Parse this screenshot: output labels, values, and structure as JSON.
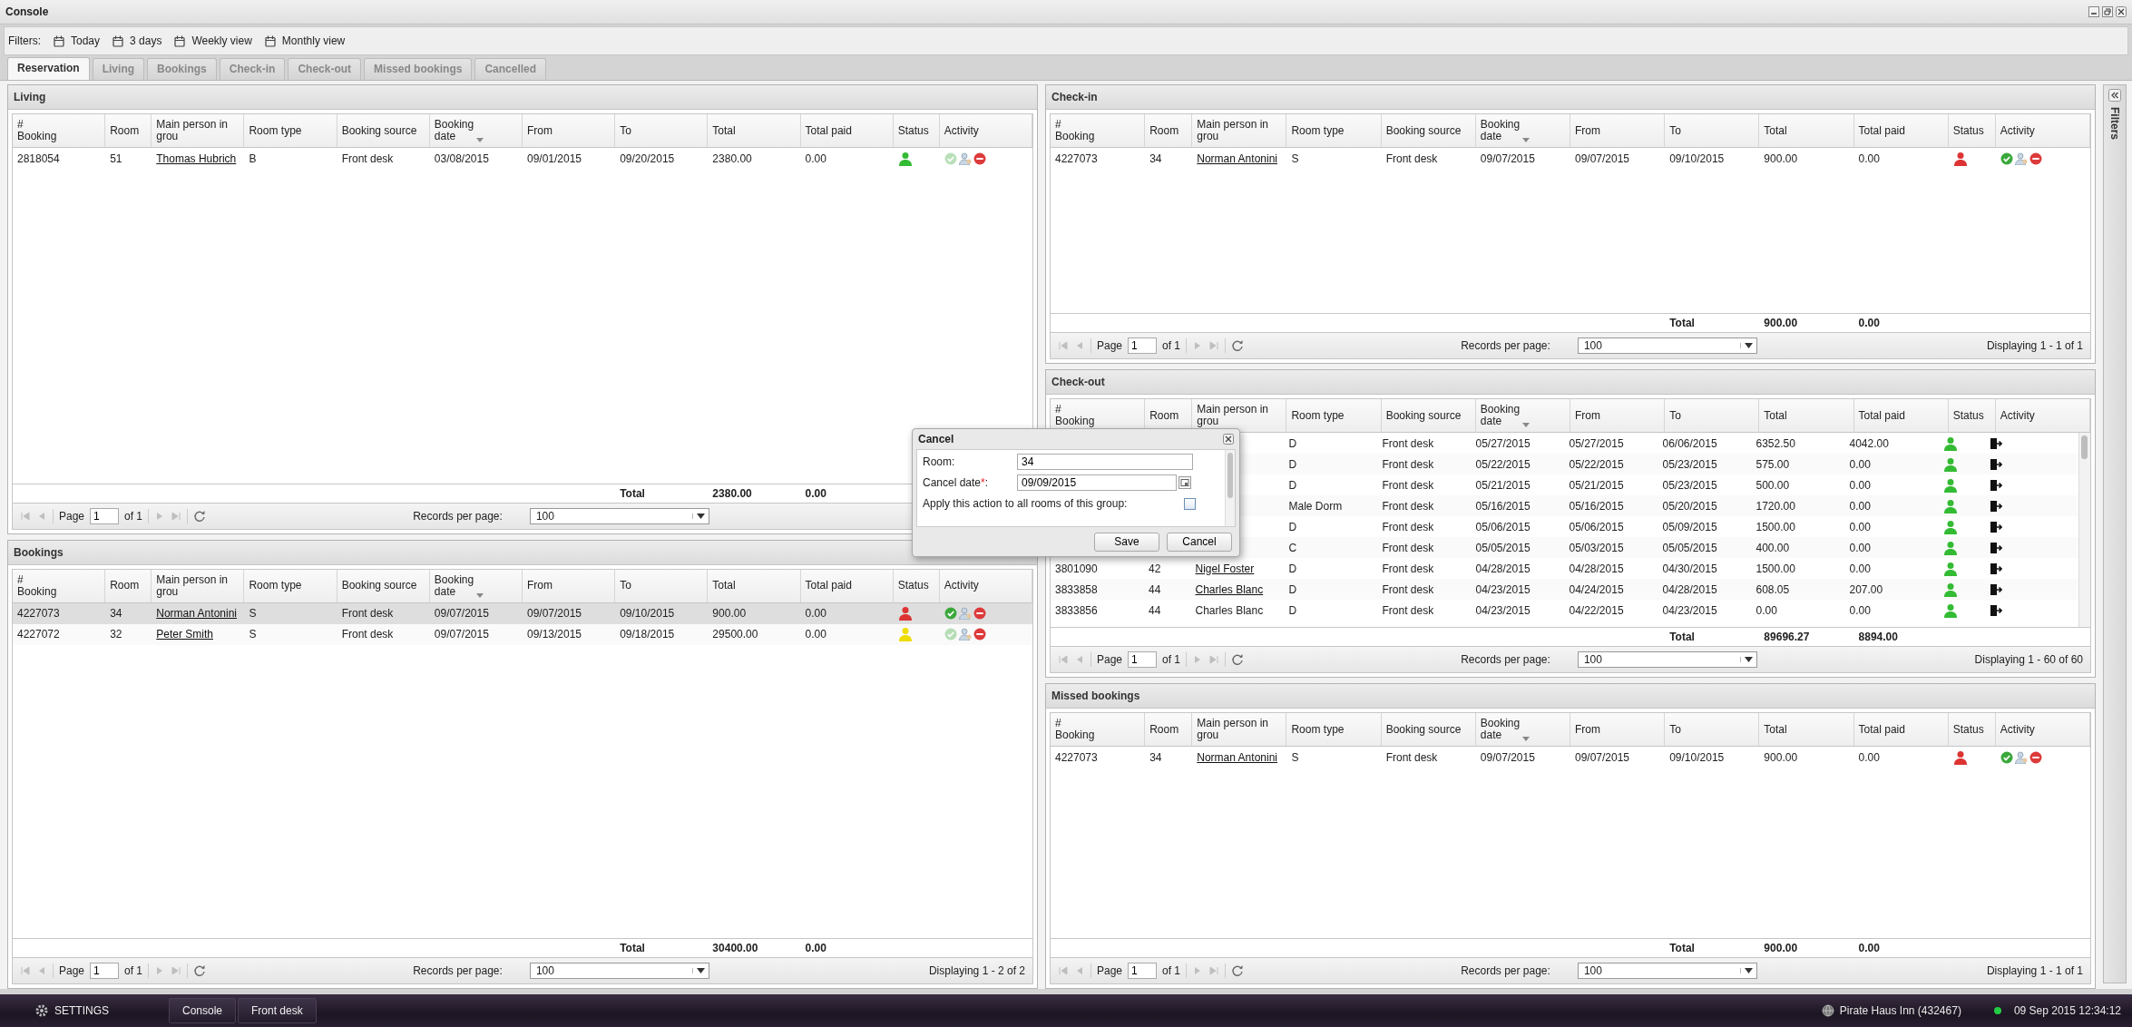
{
  "window": {
    "title": "Console"
  },
  "filters": {
    "label": "Filters:",
    "items": [
      "Today",
      "3 days",
      "Weekly view",
      "Monthly view"
    ]
  },
  "tabs": [
    {
      "label": "Reservation",
      "selected": true
    },
    {
      "label": "Living",
      "selected": false
    },
    {
      "label": "Bookings",
      "selected": false
    },
    {
      "label": "Check-in",
      "selected": false
    },
    {
      "label": "Check-out",
      "selected": false
    },
    {
      "label": "Missed bookings",
      "selected": false
    },
    {
      "label": "Cancelled",
      "selected": false
    }
  ],
  "panels": {
    "left": [
      {
        "title": "Living",
        "kind": "checkin",
        "columns": [
          {
            "label": "#\nBooking",
            "sorted": false
          },
          {
            "label": "Room",
            "sorted": false
          },
          {
            "label": "Main person in grou",
            "sorted": false
          },
          {
            "label": "Room type",
            "sorted": false
          },
          {
            "label": "Booking source",
            "sorted": false
          },
          {
            "label": "Booking\ndate",
            "sorted": true
          },
          {
            "label": "From",
            "sorted": false
          },
          {
            "label": "To",
            "sorted": false
          },
          {
            "label": "Total",
            "sorted": false
          },
          {
            "label": "Total paid",
            "sorted": false
          },
          {
            "label": "Status",
            "sorted": false
          },
          {
            "label": "Activity",
            "sorted": false
          }
        ],
        "rows": [
          {
            "booking": "2818054",
            "room": "51",
            "person": "Thomas Hubrich",
            "link": true,
            "room_type": "B",
            "source": "Front desk",
            "booking_date": "03/08/2015",
            "from": "09/01/2015",
            "to": "09/20/2015",
            "total": "2380.00",
            "total_paid": "0.00",
            "color": "#33bb33",
            "checkin_enabled": false,
            "selected": false
          }
        ],
        "totals": {
          "label": "Total",
          "total": "2380.00",
          "total_paid": "0.00"
        },
        "pager": {
          "page_label": "Page",
          "page": "1",
          "of": "of 1",
          "records_label": "Records per page:",
          "records": "100",
          "nav_enabled": false
        }
      },
      {
        "title": "Bookings",
        "kind": "checkin",
        "columns": [
          {
            "label": "#\nBooking",
            "sorted": false
          },
          {
            "label": "Room",
            "sorted": false
          },
          {
            "label": "Main person in grou",
            "sorted": false
          },
          {
            "label": "Room type",
            "sorted": false
          },
          {
            "label": "Booking source",
            "sorted": false
          },
          {
            "label": "Booking\ndate",
            "sorted": true
          },
          {
            "label": "From",
            "sorted": false
          },
          {
            "label": "To",
            "sorted": false
          },
          {
            "label": "Total",
            "sorted": false
          },
          {
            "label": "Total paid",
            "sorted": false
          },
          {
            "label": "Status",
            "sorted": false
          },
          {
            "label": "Activity",
            "sorted": false
          }
        ],
        "rows": [
          {
            "booking": "4227073",
            "room": "34",
            "person": "Norman Antonini",
            "link": true,
            "room_type": "S",
            "source": "Front desk",
            "booking_date": "09/07/2015",
            "from": "09/07/2015",
            "to": "09/10/2015",
            "total": "900.00",
            "total_paid": "0.00",
            "color": "#dd3333",
            "checkin_enabled": true,
            "selected": true
          },
          {
            "booking": "4227072",
            "room": "32",
            "person": "Peter Smith",
            "link": true,
            "room_type": "S",
            "source": "Front desk",
            "booking_date": "09/07/2015",
            "from": "09/13/2015",
            "to": "09/18/2015",
            "total": "29500.00",
            "total_paid": "0.00",
            "color": "#eedd00",
            "checkin_enabled": false,
            "selected": false
          }
        ],
        "totals": {
          "label": "Total",
          "total": "30400.00",
          "total_paid": "0.00"
        },
        "pager": {
          "page_label": "Page",
          "page": "1",
          "of": "of 1",
          "records_label": "Records per page:",
          "records": "100",
          "displaying": "Displaying 1 - 2 of 2",
          "nav_enabled": false
        }
      }
    ],
    "right": [
      {
        "title": "Check-in",
        "kind": "checkin",
        "columns": [
          {
            "label": "#\nBooking",
            "sorted": false
          },
          {
            "label": "Room",
            "sorted": false
          },
          {
            "label": "Main person in grou",
            "sorted": false
          },
          {
            "label": "Room type",
            "sorted": false
          },
          {
            "label": "Booking source",
            "sorted": false
          },
          {
            "label": "Booking\ndate",
            "sorted": true
          },
          {
            "label": "From",
            "sorted": false
          },
          {
            "label": "To",
            "sorted": false
          },
          {
            "label": "Total",
            "sorted": false
          },
          {
            "label": "Total paid",
            "sorted": false
          },
          {
            "label": "Status",
            "sorted": false
          },
          {
            "label": "Activity",
            "sorted": false
          }
        ],
        "rows": [
          {
            "booking": "4227073",
            "room": "34",
            "person": "Norman Antonini",
            "link": true,
            "room_type": "S",
            "source": "Front desk",
            "booking_date": "09/07/2015",
            "from": "09/07/2015",
            "to": "09/10/2015",
            "total": "900.00",
            "total_paid": "0.00",
            "color": "#dd3333",
            "checkin_enabled": true,
            "selected": false
          }
        ],
        "totals": {
          "label": "Total",
          "total": "900.00",
          "total_paid": "0.00"
        },
        "pager": {
          "page_label": "Page",
          "page": "1",
          "of": "of 1",
          "records_label": "Records per page:",
          "records": "100",
          "displaying": "Displaying 1 - 1 of 1",
          "nav_enabled": false
        }
      },
      {
        "title": "Check-out",
        "kind": "checkout",
        "columns": [
          {
            "label": "#\nBooking",
            "sorted": false
          },
          {
            "label": "Room",
            "sorted": false
          },
          {
            "label": "Main person in grou",
            "sorted": false
          },
          {
            "label": "Room type",
            "sorted": false
          },
          {
            "label": "Booking source",
            "sorted": false
          },
          {
            "label": "Booking\ndate",
            "sorted": true
          },
          {
            "label": "From",
            "sorted": false
          },
          {
            "label": "To",
            "sorted": false
          },
          {
            "label": "Total",
            "sorted": false
          },
          {
            "label": "Total paid",
            "sorted": false
          },
          {
            "label": "Status",
            "sorted": false
          },
          {
            "label": "Activity",
            "sorted": false
          }
        ],
        "rows": [
          {
            "room_type": "D",
            "source": "Front desk",
            "booking_date": "05/27/2015",
            "from": "05/27/2015",
            "to": "06/06/2015",
            "total": "6352.50",
            "total_paid": "4042.00",
            "color": "#33bb33",
            "selected": false
          },
          {
            "room_type": "D",
            "source": "Front desk",
            "booking_date": "05/22/2015",
            "from": "05/22/2015",
            "to": "05/23/2015",
            "total": "575.00",
            "total_paid": "0.00",
            "color": "#33bb33",
            "selected": false
          },
          {
            "room_type": "D",
            "source": "Front desk",
            "booking_date": "05/21/2015",
            "from": "05/21/2015",
            "to": "05/23/2015",
            "total": "500.00",
            "total_paid": "0.00",
            "color": "#33bb33",
            "selected": false
          },
          {
            "room_type": "Male Dorm",
            "source": "Front desk",
            "booking_date": "05/16/2015",
            "from": "05/16/2015",
            "to": "05/20/2015",
            "total": "1720.00",
            "total_paid": "0.00",
            "color": "#33bb33",
            "selected": false
          },
          {
            "room_type": "D",
            "source": "Front desk",
            "booking_date": "05/06/2015",
            "from": "05/06/2015",
            "to": "05/09/2015",
            "total": "1500.00",
            "total_paid": "0.00",
            "color": "#33bb33",
            "selected": false
          },
          {
            "room_type": "C",
            "source": "Front desk",
            "booking_date": "05/05/2015",
            "from": "05/03/2015",
            "to": "05/05/2015",
            "total": "400.00",
            "total_paid": "0.00",
            "color": "#33bb33",
            "selected": false
          },
          {
            "booking": "3801090",
            "room": "42",
            "person": "Nigel Foster",
            "link": true,
            "room_type": "D",
            "source": "Front desk",
            "booking_date": "04/28/2015",
            "from": "04/28/2015",
            "to": "04/30/2015",
            "total": "1500.00",
            "total_paid": "0.00",
            "color": "#33bb33",
            "selected": false
          },
          {
            "booking": "3833858",
            "room": "44",
            "person": "Charles Blanc",
            "link": true,
            "room_type": "D",
            "source": "Front desk",
            "booking_date": "04/23/2015",
            "from": "04/24/2015",
            "to": "04/28/2015",
            "total": "608.05",
            "total_paid": "207.00",
            "color": "#33bb33",
            "selected": false
          },
          {
            "booking": "3833856",
            "room": "44",
            "person": "Charles Blanc",
            "link": false,
            "room_type": "D",
            "source": "Front desk",
            "booking_date": "04/23/2015",
            "from": "04/22/2015",
            "to": "04/23/2015",
            "total": "0.00",
            "total_paid": "0.00",
            "color": "#33bb33",
            "selected": false
          }
        ],
        "totals": {
          "label": "Total",
          "total": "89696.27",
          "total_paid": "8894.00"
        },
        "pager": {
          "page_label": "Page",
          "page": "1",
          "of": "of 1",
          "records_label": "Records per page:",
          "records": "100",
          "displaying": "Displaying 1 - 60 of 60",
          "nav_enabled": false
        }
      },
      {
        "title": "Missed bookings",
        "kind": "checkin",
        "columns": [
          {
            "label": "#\nBooking",
            "sorted": false
          },
          {
            "label": "Room",
            "sorted": false
          },
          {
            "label": "Main person in grou",
            "sorted": false
          },
          {
            "label": "Room type",
            "sorted": false
          },
          {
            "label": "Booking source",
            "sorted": false
          },
          {
            "label": "Booking\ndate",
            "sorted": true
          },
          {
            "label": "From",
            "sorted": false
          },
          {
            "label": "To",
            "sorted": false
          },
          {
            "label": "Total",
            "sorted": false
          },
          {
            "label": "Total paid",
            "sorted": false
          },
          {
            "label": "Status",
            "sorted": false
          },
          {
            "label": "Activity",
            "sorted": false
          }
        ],
        "rows": [
          {
            "booking": "4227073",
            "room": "34",
            "person": "Norman Antonini",
            "link": true,
            "room_type": "S",
            "source": "Front desk",
            "booking_date": "09/07/2015",
            "from": "09/07/2015",
            "to": "09/10/2015",
            "total": "900.00",
            "total_paid": "0.00",
            "color": "#dd3333",
            "checkin_enabled": true,
            "selected": false
          }
        ],
        "totals": {
          "label": "Total",
          "total": "900.00",
          "total_paid": "0.00"
        },
        "pager": {
          "page_label": "Page",
          "page": "1",
          "of": "of 1",
          "records_label": "Records per page:",
          "records": "100",
          "displaying": "Displaying 1 - 1 of 1",
          "nav_enabled": false
        }
      }
    ]
  },
  "side_panel": {
    "title": "Filters"
  },
  "dialog": {
    "title": "Cancel",
    "fields": [
      {
        "kind": "text",
        "label": "Room:",
        "value": "34"
      },
      {
        "kind": "date",
        "label": "Cancel date",
        "required_mark": "*",
        "label_end": ":",
        "value": "09/09/2015"
      }
    ],
    "checkbox": {
      "label": "Apply this action to all rooms of this group:",
      "checked": false
    },
    "buttons": [
      "Save",
      "Cancel"
    ]
  },
  "taskbar": {
    "settings": "SETTINGS",
    "buttons": [
      "Console",
      "Front desk"
    ],
    "hotel": "Pirate Haus Inn (432467)",
    "datetime": "09 Sep 2015 12:34:12"
  }
}
